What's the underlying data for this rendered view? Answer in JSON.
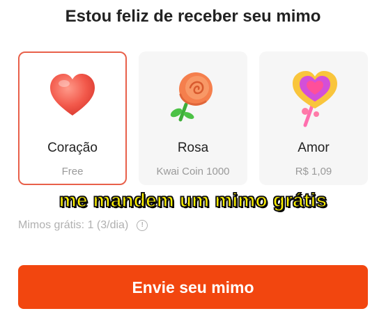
{
  "header": {
    "title": "Estou feliz de receber seu mimo"
  },
  "gifts": [
    {
      "name": "Coração",
      "price": "Free",
      "icon": "heart-icon",
      "selected": true
    },
    {
      "name": "Rosa",
      "price": "Kwai Coin 1000",
      "icon": "rose-icon",
      "selected": false
    },
    {
      "name": "Amor",
      "price": "R$ 1,09",
      "icon": "heart-lollipop-icon",
      "selected": false
    }
  ],
  "caption": "me mandem um mimo grátis",
  "free_info": {
    "text": "Mimos grátis: 1 (3/dia)",
    "icon": "info-icon"
  },
  "send_button": {
    "label": "Envie seu mimo"
  },
  "colors": {
    "accent": "#f2460f",
    "selected_border": "#e8604a",
    "caption": "#fff200"
  }
}
